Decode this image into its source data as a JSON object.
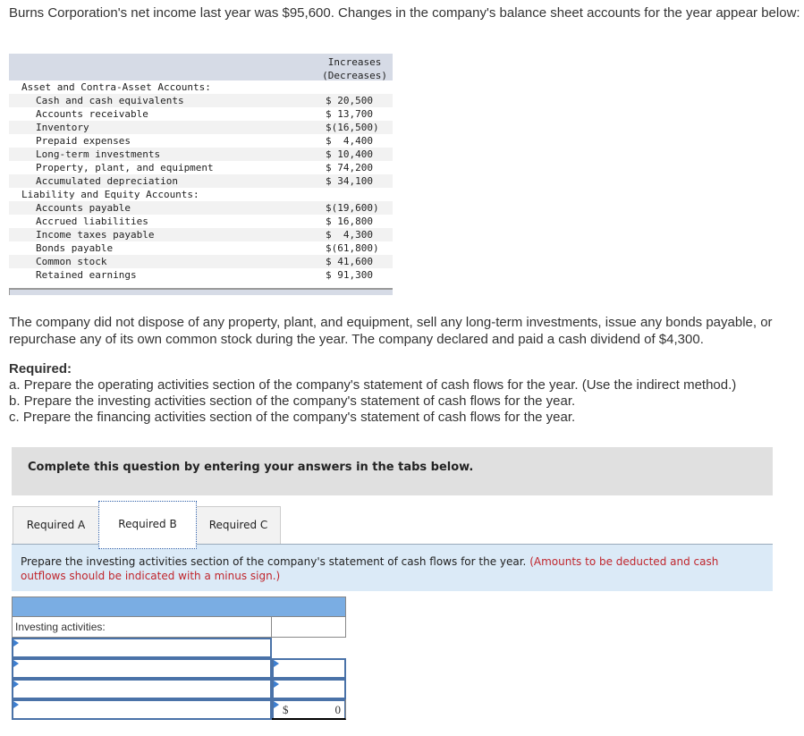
{
  "intro": "Burns Corporation's net income last year was $95,600. Changes in the company's balance sheet accounts for the year appear below:",
  "balance_sheet": {
    "column_header_line1": "Increases",
    "column_header_line2": "(Decreases)",
    "sections": [
      {
        "title": "Asset and Contra-Asset Accounts:",
        "items": [
          {
            "label": "Cash and cash equivalents",
            "value": "$ 20,500"
          },
          {
            "label": "Accounts receivable",
            "value": "$ 13,700"
          },
          {
            "label": "Inventory",
            "value": "$(16,500)"
          },
          {
            "label": "Prepaid expenses",
            "value": "$  4,400"
          },
          {
            "label": "Long-term investments",
            "value": "$ 10,400"
          },
          {
            "label": "Property, plant, and equipment",
            "value": "$ 74,200"
          },
          {
            "label": "Accumulated depreciation",
            "value": "$ 34,100"
          }
        ]
      },
      {
        "title": "Liability and Equity Accounts:",
        "items": [
          {
            "label": "Accounts payable",
            "value": "$(19,600)"
          },
          {
            "label": "Accrued liabilities",
            "value": "$ 16,800"
          },
          {
            "label": "Income taxes payable",
            "value": "$  4,300"
          },
          {
            "label": "Bonds payable",
            "value": "$(61,800)"
          },
          {
            "label": "Common stock",
            "value": "$ 41,600"
          },
          {
            "label": "Retained earnings",
            "value": "$ 91,300"
          }
        ]
      }
    ]
  },
  "paragraph": "The company did not dispose of any property, plant, and equipment, sell any long-term investments, issue any bonds payable, or repurchase any of its own common stock during the year. The company declared and paid a cash dividend of $4,300.",
  "required": {
    "title": "Required:",
    "items": [
      "a. Prepare the operating activities section of the company's statement of cash flows for the year. (Use the indirect method.)",
      "b. Prepare the investing activities section of the company's statement of cash flows for the year.",
      "c. Prepare the financing activities section of the company's statement of cash flows for the year."
    ]
  },
  "banner": "Complete this question by entering your answers in the tabs below.",
  "tabs": [
    {
      "label": "Required A",
      "active": false
    },
    {
      "label": "Required B",
      "active": true
    },
    {
      "label": "Required C",
      "active": false
    }
  ],
  "instruction": {
    "text": "Prepare the investing activities section of the company's statement of cash flows for the year.",
    "note": "(Amounts to be deducted and cash outflows should be indicated with a minus sign.)"
  },
  "answer_table": {
    "section_label": "Investing activities:",
    "rows": [
      {
        "label_value": "",
        "amount_value": ""
      },
      {
        "label_value": "",
        "amount_value": ""
      },
      {
        "label_value": "",
        "amount_value": ""
      }
    ],
    "total": {
      "label_value": "",
      "currency": "$",
      "amount": "0"
    }
  }
}
